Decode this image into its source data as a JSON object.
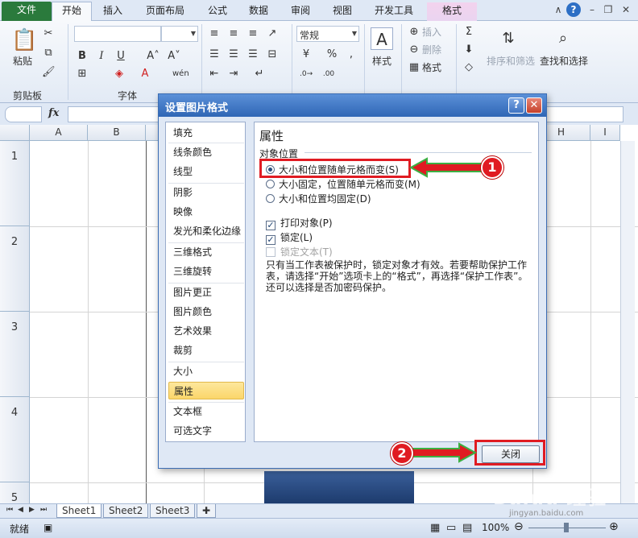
{
  "ribbon_tabs": [
    "文件",
    "开始",
    "插入",
    "页面布局",
    "公式",
    "数据",
    "审阅",
    "视图",
    "开发工具",
    "格式"
  ],
  "ribbon": {
    "clipboard": {
      "paste": "粘贴",
      "label": "剪贴板"
    },
    "font": {
      "label": "字体"
    },
    "number": {
      "format": "常规"
    },
    "styles": {
      "label": "样式"
    },
    "cells": {
      "insert": "插入",
      "delete": "删除",
      "format": "格式"
    },
    "editing": {
      "sort_filter": "排序和筛选",
      "find_select": "查找和选择"
    }
  },
  "formula_bar": {
    "fx": "fx"
  },
  "grid": {
    "columns": [
      "A",
      "B",
      "H",
      "I"
    ],
    "rows": [
      "1",
      "2",
      "3",
      "4",
      "5"
    ]
  },
  "sheets": [
    "Sheet1",
    "Sheet2",
    "Sheet3"
  ],
  "status": {
    "ready": "就绪",
    "zoom": "100%"
  },
  "dialog": {
    "title": "设置图片格式",
    "help": "?",
    "close_x": "✕",
    "nav": [
      "填充",
      "线条颜色",
      "线型",
      "阴影",
      "映像",
      "发光和柔化边缘",
      "三维格式",
      "三维旋转",
      "图片更正",
      "图片颜色",
      "艺术效果",
      "裁剪",
      "大小",
      "属性",
      "文本框",
      "可选文字"
    ],
    "selected_nav": "属性",
    "heading": "属性",
    "section": "对象位置",
    "radio_options": [
      {
        "label": "大小和位置随单元格而变(S)",
        "checked": true
      },
      {
        "label": "大小固定，位置随单元格而变(M)",
        "checked": false
      },
      {
        "label": "大小和位置均固定(D)",
        "checked": false
      }
    ],
    "checkboxes": [
      {
        "label": "打印对象(P)",
        "checked": true,
        "enabled": true
      },
      {
        "label": "锁定(L)",
        "checked": true,
        "enabled": true
      },
      {
        "label": "锁定文本(T)",
        "checked": false,
        "enabled": false
      }
    ],
    "note": "只有当工作表被保护时，锁定对象才有效。若要帮助保护工作表，请选择“开始”选项卡上的“格式”，再选择“保护工作表”。还可以选择是否加密码保护。",
    "close_button": "关闭"
  },
  "annotations": {
    "step1": "1",
    "step2": "2"
  },
  "watermark": {
    "text": "Baidu 经验",
    "url": "jingyan.baidu.com"
  },
  "colors": {
    "file_tab": "#2a7a3c",
    "annotation_red": "#e01b22",
    "annotation_green": "#3cb043",
    "dialog_title": "#2f66b5"
  }
}
